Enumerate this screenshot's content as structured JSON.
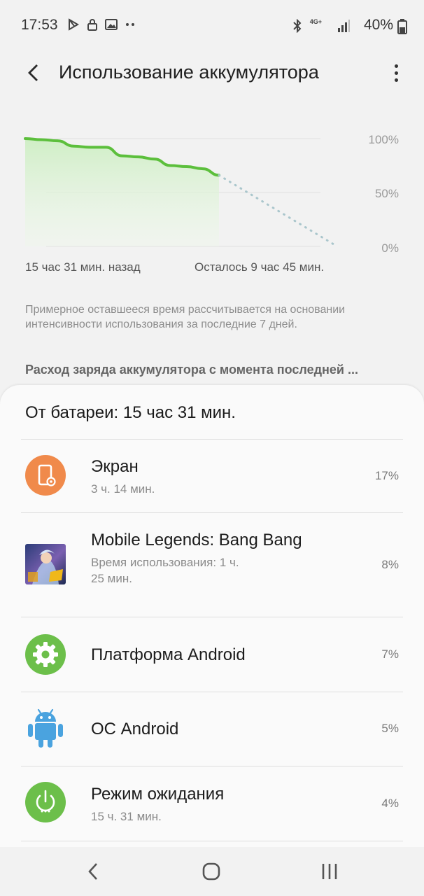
{
  "status": {
    "time": "17:53",
    "network": "4G+",
    "battery": "40%"
  },
  "header": {
    "title": "Использование аккумулятора"
  },
  "chart_data": {
    "type": "line",
    "y_ticks": [
      "100%",
      "50%",
      "0%"
    ],
    "ylim": [
      0,
      100
    ],
    "x_start_label": "15 час 31 мин. назад",
    "x_end_label": "Осталось 9 час 45 мин.",
    "series": [
      {
        "style": "solid",
        "color": "#5cbf3c",
        "values": [
          100,
          99,
          98,
          93,
          92,
          92,
          84,
          83,
          81,
          75,
          74,
          72,
          66
        ]
      },
      {
        "style": "dotted",
        "color": "#aac6cc",
        "values": [
          66,
          0
        ]
      }
    ]
  },
  "note": "Примерное оставшееся время рассчитывается на основании интенсивности использования за последние 7 дней.",
  "section_title": "Расход заряда аккумулятора с момента последней ...",
  "sheet": {
    "header": "От батареи: 15 час 31 мин.",
    "items": [
      {
        "icon": "screen-icon",
        "color": "#f08a4b",
        "title": "Экран",
        "sub": "3 ч. 14 мин.",
        "percent": "17%"
      },
      {
        "icon": "game-thumbnail-icon",
        "title": "Mobile Legends: Bang Bang",
        "sub": "Время использования: 1 ч. 25 мин.",
        "percent": "8%"
      },
      {
        "icon": "gear-icon",
        "color": "#6cbf4a",
        "title": "Платформа Android",
        "sub": "",
        "percent": "7%"
      },
      {
        "icon": "android-icon",
        "color": "#4aa3df",
        "title": "ОС Android",
        "sub": "",
        "percent": "5%"
      },
      {
        "icon": "power-icon",
        "color": "#6cbf4a",
        "title": "Режим ожидания",
        "sub": "15 ч. 31 мин.",
        "percent": "4%"
      }
    ]
  }
}
